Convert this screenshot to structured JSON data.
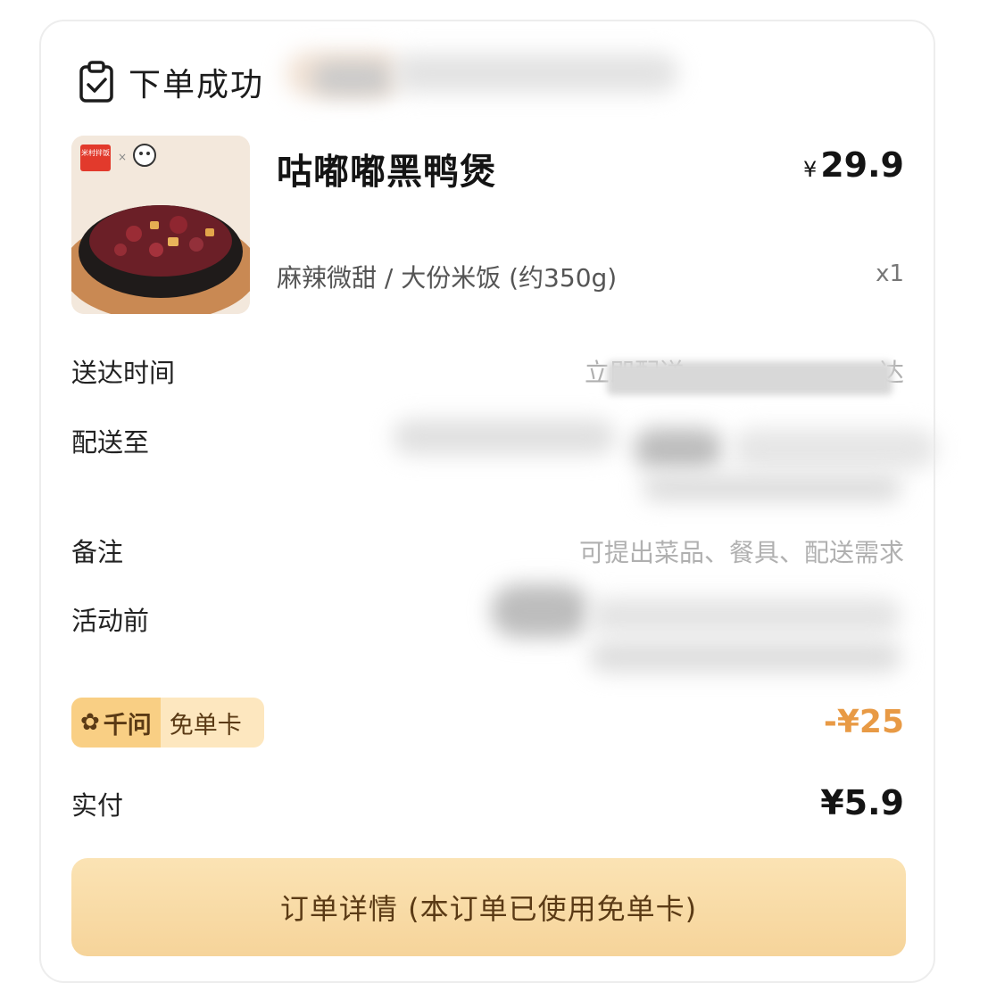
{
  "header": {
    "title": "下单成功",
    "icon": "clipboard-check-icon"
  },
  "item": {
    "name": "咕嘟嘟黑鸭煲",
    "currency": "¥",
    "price": "29.9",
    "spec": "麻辣微甜 / 大份米饭 (约350g)",
    "quantity": "x1",
    "thumb_brand": "米村拌饭"
  },
  "rows": {
    "delivery_time_label": "送达时间",
    "delivery_time_value": "立即配送",
    "delivery_time_suffix": "达",
    "delivery_to_label": "配送至",
    "remark_label": "备注",
    "remark_placeholder": "可提出菜品、餐具、配送需求",
    "promo_label": "活动前"
  },
  "coupon": {
    "brand": "千问",
    "name": "免单卡",
    "discount": "-¥25"
  },
  "payment": {
    "label": "实付",
    "amount": "¥5.9"
  },
  "button": {
    "label": "订单详情 (本订单已使用免单卡)"
  },
  "colors": {
    "accent": "#e89a45",
    "button_bg": "#f6d49a",
    "badge_bg": "#fde7bf",
    "badge_dark": "#f9cf84",
    "text_brown": "#5a3a15"
  }
}
